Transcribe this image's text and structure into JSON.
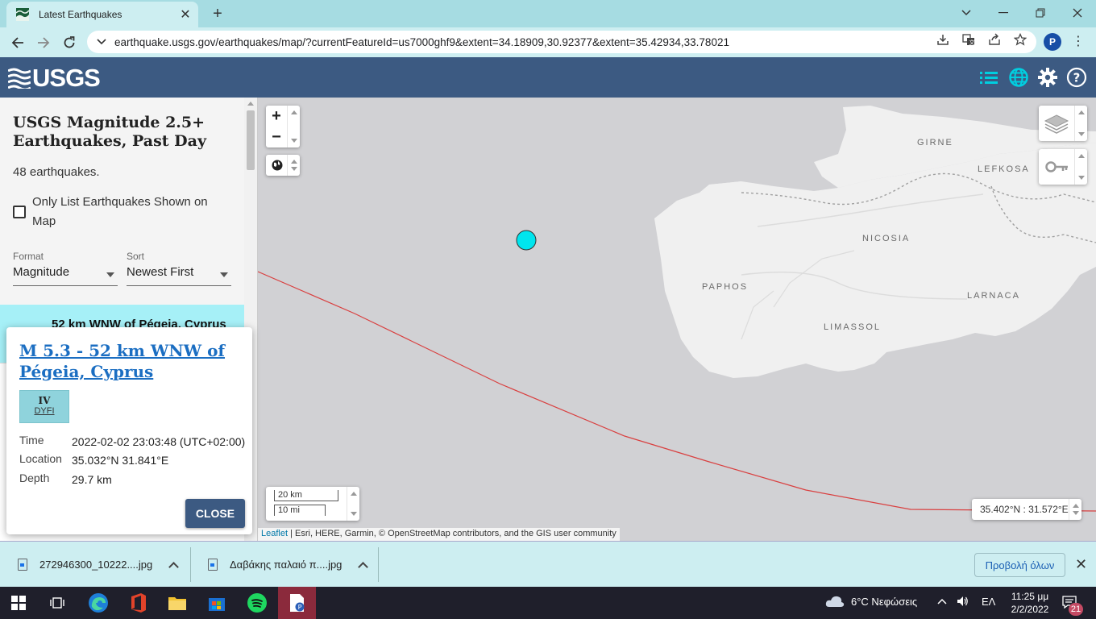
{
  "browser": {
    "tab_title": "Latest Earthquakes",
    "url": "earthquake.usgs.gov/earthquakes/map/?currentFeatureId=us7000ghf9&extent=34.18909,30.92377&extent=35.42934,33.78021",
    "profile_initial": "P"
  },
  "usgs": {
    "logo_text": "USGS"
  },
  "sidebar": {
    "title": "USGS Magnitude 2.5+ Earthquakes, Past Day",
    "count": "48 earthquakes.",
    "only_list_label": "Only List Earthquakes Shown on Map",
    "format_label": "Format",
    "format_value": "Magnitude",
    "sort_label": "Sort",
    "sort_value": "Newest First",
    "item_place": "52 km WNW of Pégeia, Cyprus"
  },
  "popup": {
    "title": "M 5.3 - 52 km WNW of Pégeia, Cyprus",
    "dyfi_level": "IV",
    "dyfi_label": "DYFI",
    "time_label": "Time",
    "time_value": "2022-02-02 23:03:48 (UTC+02:00)",
    "location_label": "Location",
    "location_value": "35.032°N 31.841°E",
    "depth_label": "Depth",
    "depth_value": "29.7 km",
    "close_label": "CLOSE"
  },
  "map": {
    "zoom_in": "+",
    "zoom_out": "−",
    "places": {
      "girne": "GIRNE",
      "lefkosa": "LEFKOSA",
      "nicosia": "NICOSIA",
      "paphos": "PAPHOS",
      "larnaca": "LARNACA",
      "limassol": "LIMASSOL"
    },
    "scale_km": "20 km",
    "scale_mi": "10 mi",
    "coords": "35.402°N : 31.572°E",
    "attribution_leaflet": "Leaflet",
    "attribution_rest": " | Esri, HERE, Garmin, © OpenStreetMap contributors, and the GIS user community",
    "colors": {
      "sea": "#d1d1d4",
      "land": "#f0f0f0",
      "quake": "#00e5ee",
      "plate_boundary": "#d94040"
    }
  },
  "downloads": {
    "item1": "272946300_10222....jpg",
    "item2": "Δαβάκης παλαιό π....jpg",
    "show_all": "Προβολή όλων"
  },
  "taskbar": {
    "weather": "6°C Νεφώσεις",
    "lang": "ΕΛ",
    "time": "11:25 μμ",
    "date": "2/2/2022",
    "notifications": "21"
  }
}
